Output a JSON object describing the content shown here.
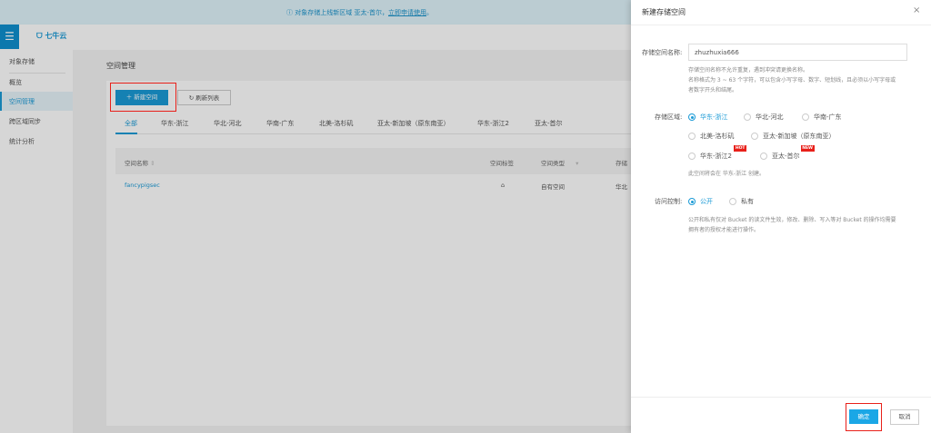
{
  "banner": {
    "text": "对象存储上线新区域 亚太-首尔，",
    "link": "立即申请使用",
    "suffix": "。"
  },
  "header": {
    "logo": "七牛云"
  },
  "sidebar": {
    "section": "对象存储",
    "items": [
      "概览",
      "空间管理",
      "跨区域同步",
      "统计分析"
    ]
  },
  "main": {
    "title": "空间管理",
    "new_button": "新建空间",
    "refresh_button": "刷新列表",
    "tabs": [
      "全部",
      "华东-浙江",
      "华北-河北",
      "华南-广东",
      "北美-洛杉矶",
      "亚太-新加坡（原东南亚）",
      "华东-浙江2",
      "亚太-首尔"
    ],
    "table": {
      "headers": [
        "空间名称",
        "空间标签",
        "空间类型",
        "存储"
      ],
      "rows": [
        {
          "name": "fancypigsec",
          "type": "自有空间",
          "region": "华北"
        }
      ]
    }
  },
  "drawer": {
    "title": "新建存储空间",
    "name_label": "存储空间名称:",
    "name_value": "zhuzhuxia666",
    "name_hint1": "存储空间名称不允许重复，遇到冲突请更换名称。",
    "name_hint2": "名称格式为 3 ~ 63 个字符，可以包含小写字母、数字、短划线，且必须以小写字母或",
    "name_hint3": "者数字开头和结尾。",
    "region_label": "存储区域:",
    "regions": [
      "华东-浙江",
      "华北-河北",
      "华南-广东",
      "北美-洛杉矶",
      "亚太-新加坡（原东南亚）",
      "华东-浙江2",
      "亚太-首尔"
    ],
    "badge_hot": "HOT",
    "badge_new": "NEW",
    "region_note": "此空间将会在 华东-浙江 创建。",
    "access_label": "访问控制:",
    "access_options": [
      "公开",
      "私有"
    ],
    "access_hint1": "公开和私有仅对 Bucket 的读文件生效，修改、删除、写入等对 Bucket 的操作均需要",
    "access_hint2": "拥有者的授权才能进行操作。",
    "ok": "确定",
    "cancel": "取消"
  },
  "colors": {
    "accent": "#1a9ad6",
    "highlight": "#e8201a"
  }
}
